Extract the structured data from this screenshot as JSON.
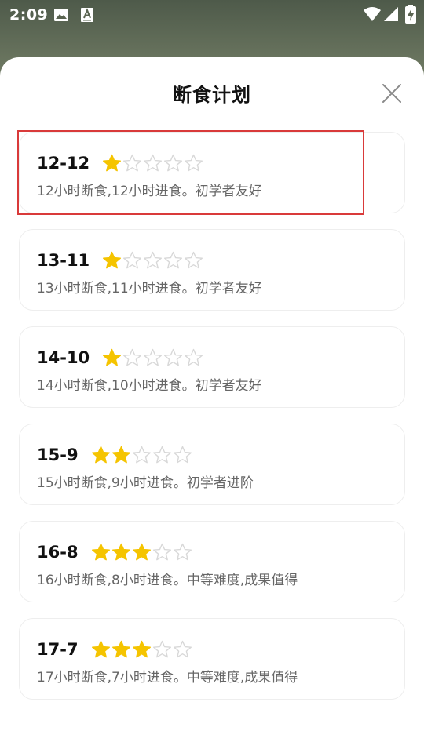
{
  "status_bar": {
    "time": "2:09",
    "icons": [
      "image-icon",
      "keyboard-a-icon",
      "wifi-icon",
      "signal-icon",
      "battery-charging-icon"
    ]
  },
  "sheet": {
    "title": "断食计划",
    "close_icon": "close-icon"
  },
  "colors": {
    "star_filled": "#f5c400",
    "star_empty": "#d8d8d8",
    "selection_border": "#d93a3a"
  },
  "plans": [
    {
      "name": "12-12",
      "desc": "12小时断食,12小时进食。初学者友好",
      "stars_filled": 1,
      "stars_total": 5,
      "selected": true
    },
    {
      "name": "13-11",
      "desc": "13小时断食,11小时进食。初学者友好",
      "stars_filled": 1,
      "stars_total": 5,
      "selected": false
    },
    {
      "name": "14-10",
      "desc": "14小时断食,10小时进食。初学者友好",
      "stars_filled": 1,
      "stars_total": 5,
      "selected": false
    },
    {
      "name": "15-9",
      "desc": "15小时断食,9小时进食。初学者进阶",
      "stars_filled": 2,
      "stars_total": 5,
      "selected": false
    },
    {
      "name": "16-8",
      "desc": "16小时断食,8小时进食。中等难度,成果值得",
      "stars_filled": 3,
      "stars_total": 5,
      "selected": false
    },
    {
      "name": "17-7",
      "desc": "17小时断食,7小时进食。中等难度,成果值得",
      "stars_filled": 3,
      "stars_total": 5,
      "selected": false
    }
  ]
}
